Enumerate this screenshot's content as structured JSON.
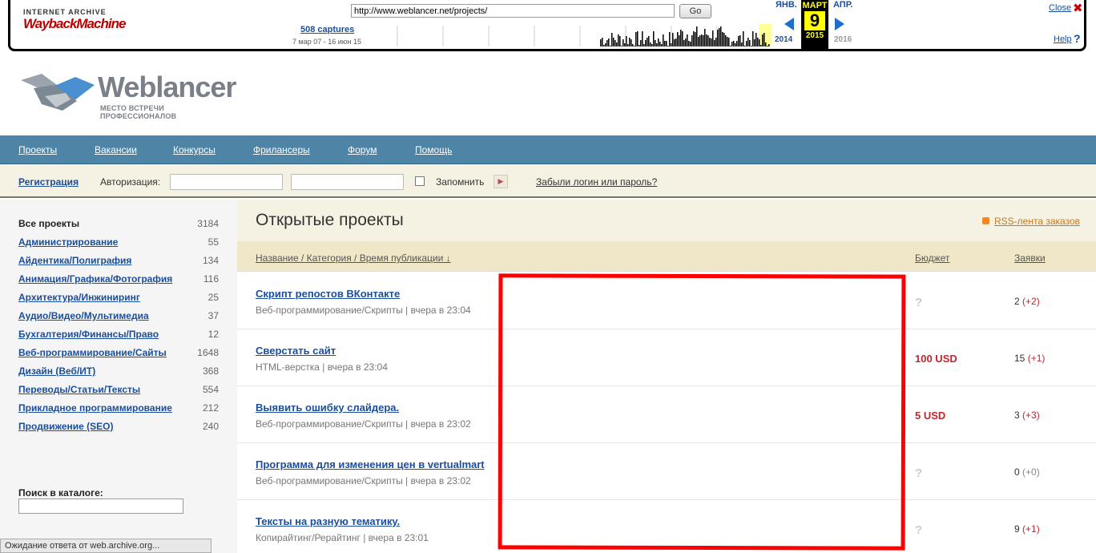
{
  "wayback": {
    "logo_top": "INTERNET ARCHIVE",
    "logo_main": "WaybackMachine",
    "url": "http://www.weblancer.net/projects/",
    "go_label": "Go",
    "captures": "508 captures",
    "range": "7 мар 07 - 16 июн 15",
    "prev_month": "ЯНВ.",
    "cur_month": "МАРТ",
    "next_month": "АПР.",
    "cur_day": "9",
    "prev_year": "2014",
    "cur_year": "2015",
    "next_year": "2016",
    "close": "Close",
    "help": "Help",
    "close_icon": "close-x-icon",
    "help_icon": "question-icon"
  },
  "logo": {
    "name": "Weblancer",
    "tagline": "МЕСТО ВСТРЕЧИ ПРОФЕССИОНАЛОВ"
  },
  "nav": [
    "Проекты",
    "Вакансии",
    "Конкурсы",
    "Фрилансеры",
    "Форум",
    "Помощь"
  ],
  "auth": {
    "register": "Регистрация",
    "login_label": "Авторизация:",
    "remember": "Запомнить",
    "forgot": "Забыли логин или пароль?"
  },
  "sidebar": {
    "categories": [
      {
        "name": "Все проекты",
        "count": "3184"
      },
      {
        "name": "Администрирование",
        "count": "55"
      },
      {
        "name": "Айдентика/Полиграфия",
        "count": "134"
      },
      {
        "name": "Анимация/Графика/Фотография",
        "count": "116"
      },
      {
        "name": "Архитектура/Инжиниринг",
        "count": "25"
      },
      {
        "name": "Аудио/Видео/Мультимедиа",
        "count": "37"
      },
      {
        "name": "Бухгалтерия/Финансы/Право",
        "count": "12"
      },
      {
        "name": "Веб-программирование/Сайты",
        "count": "1648"
      },
      {
        "name": "Дизайн (Веб/ИТ)",
        "count": "368"
      },
      {
        "name": "Переводы/Статьи/Тексты",
        "count": "554"
      },
      {
        "name": "Прикладное программирование",
        "count": "212"
      },
      {
        "name": "Продвижение (SEO)",
        "count": "240"
      }
    ],
    "search_label": "Поиск в каталоге:"
  },
  "main": {
    "title": "Открытые проекты",
    "rss": "RSS-лента заказов",
    "columns": {
      "name": "Название / Категория / Время публикации ↓",
      "budget": "Бюджет",
      "bids": "Заявки"
    },
    "projects": [
      {
        "title": "Скрипт репостов ВКонтакте",
        "meta": "Веб-программирование/Скрипты | вчера в 23:04",
        "budget": "?",
        "bids": "2",
        "delta": "(+2)"
      },
      {
        "title": "Сверстать сайт",
        "meta": "HTML-верстка | вчера в 23:04",
        "budget": "100 USD",
        "bids": "15",
        "delta": "(+1)"
      },
      {
        "title": "Выявить ошибку слайдера.",
        "meta": "Веб-программирование/Скрипты | вчера в 23:02",
        "budget": "5 USD",
        "bids": "3",
        "delta": "(+3)"
      },
      {
        "title": "Программа для изменения цен в vertualmart",
        "meta": "Веб-программирование/Скрипты | вчера в 23:02",
        "budget": "?",
        "bids": "0",
        "delta": "(+0)"
      },
      {
        "title": "Тексты на разную тематику.",
        "meta": "Копирайтинг/Рерайтинг | вчера в 23:01",
        "budget": "?",
        "bids": "9",
        "delta": "(+1)"
      }
    ]
  },
  "status_bar": "Ожидание ответа от web.archive.org...",
  "colors": {
    "nav": "#4e84a6",
    "link": "#1a4e9c",
    "budget": "#c0272d",
    "annotation": "#ff0000"
  }
}
